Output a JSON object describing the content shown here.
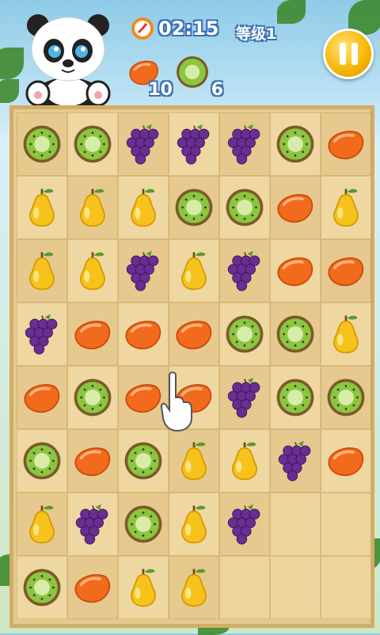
{
  "hud": {
    "timer": "02:15",
    "level": "等级1",
    "goals": [
      {
        "fruit": "mango",
        "count": "10"
      },
      {
        "fruit": "kiwi",
        "count": "6"
      }
    ]
  },
  "icons": {
    "timer": "clock-icon",
    "pause": "pause-icon",
    "character": "panda-icon",
    "hint": "pointing-hand-icon"
  },
  "board": {
    "rows": [
      [
        "kiwi",
        "kiwi",
        "grape",
        "grape",
        "grape",
        "kiwi",
        "mango"
      ],
      [
        "pear",
        "pear",
        "pear",
        "kiwi",
        "kiwi",
        "mango",
        "pear"
      ],
      [
        "pear",
        "pear",
        "grape",
        "pear",
        "grape",
        "mango",
        "mango"
      ],
      [
        "grape",
        "mango",
        "mango",
        "mango",
        "kiwi",
        "kiwi",
        "pear"
      ],
      [
        "mango",
        "kiwi",
        "mango",
        "mango",
        "grape",
        "kiwi",
        "kiwi"
      ],
      [
        "kiwi",
        "mango",
        "kiwi",
        "pear",
        "pear",
        "grape",
        "mango"
      ],
      [
        "pear",
        "grape",
        "kiwi",
        "pear",
        "grape",
        "",
        ""
      ],
      [
        "kiwi",
        "mango",
        "pear",
        "pear",
        "",
        "",
        ""
      ]
    ]
  },
  "colors": {
    "kiwi": "#8cc63f",
    "mango": "#f26a1b",
    "grape": "#6a2d91",
    "pear": "#f7c21b",
    "accent": "#f6b400"
  }
}
